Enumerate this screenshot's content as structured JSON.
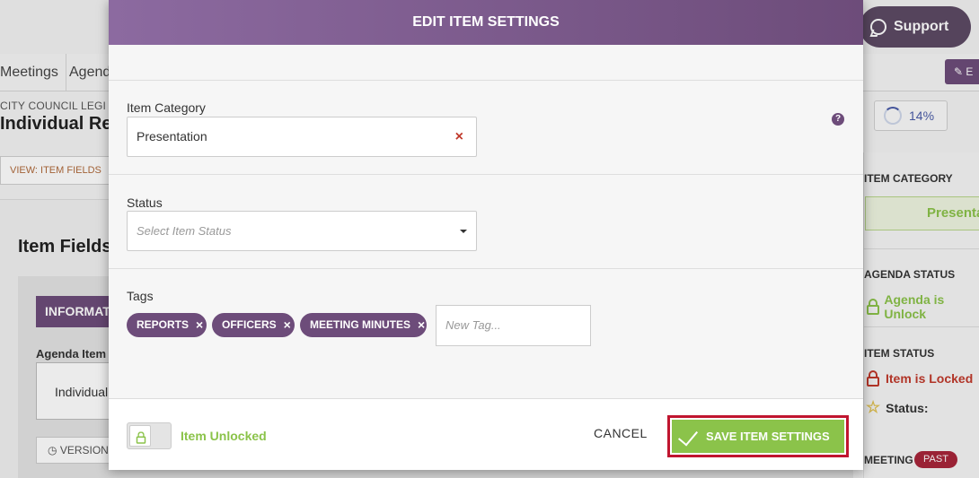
{
  "background": {
    "support_label": "Support",
    "nav_tabs": [
      "Meetings",
      "Agend"
    ],
    "edit_label": "E",
    "breadcrumb_small": "CITY COUNCIL LEGI",
    "breadcrumb_big": "Individual Rep",
    "progress": "14%",
    "view_button": "VIEW: ITEM FIELDS",
    "item_fields_title": "Item Fields",
    "info_tab": "INFORMAT",
    "agenda_item_label": "Agenda Item",
    "agenda_item_value": "Individual",
    "version_button": "VERSION",
    "right_column": {
      "item_category_head": "ITEM CATEGORY",
      "item_category_value": "Presenta",
      "agenda_status_head": "AGENDA STATUS",
      "agenda_status_value": "Agenda is Unlock",
      "item_status_head": "ITEM STATUS",
      "item_status_value": "Item is Locked",
      "status_label": "Status:",
      "meeting_head": "MEETING",
      "past_badge": "PAST"
    }
  },
  "modal": {
    "title": "EDIT ITEM SETTINGS",
    "item_category": {
      "label": "Item Category",
      "value": "Presentation",
      "clear": "×",
      "help": "?"
    },
    "status": {
      "label": "Status",
      "placeholder": "Select Item Status"
    },
    "tags": {
      "label": "Tags",
      "items": [
        "REPORTS",
        "OFFICERS",
        "MEETING MINUTES"
      ],
      "remove_glyph": "×",
      "new_tag_placeholder": "New Tag..."
    },
    "footer": {
      "lock_label": "Item Unlocked",
      "cancel_label": "CANCEL",
      "save_label": "SAVE ITEM SETTINGS"
    }
  },
  "colors": {
    "primary_purple": "#6d4c7a",
    "success_green": "#8bc34a",
    "highlight_red": "#c0152f",
    "danger_red": "#c0392b"
  }
}
